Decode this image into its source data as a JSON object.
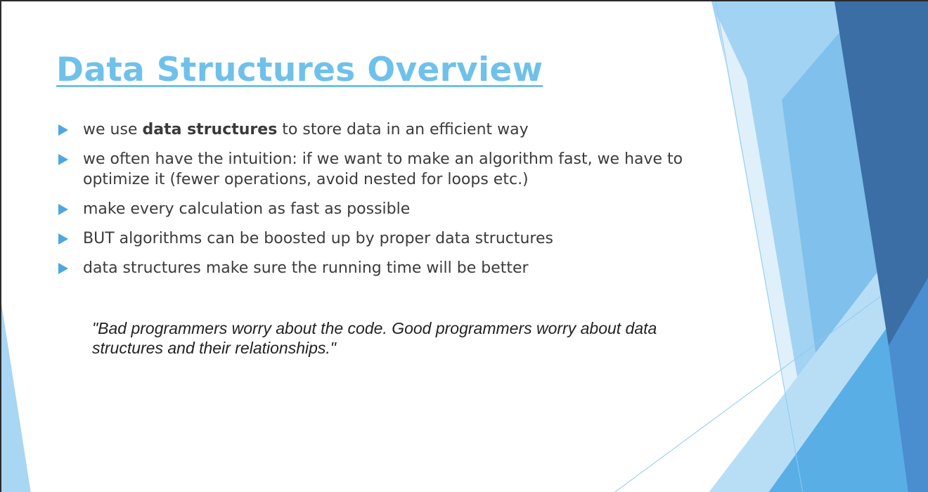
{
  "slide": {
    "title": "Data Structures Overview",
    "bullets": [
      {
        "before": "we use ",
        "bold": "data structures",
        "after": " to store data in an efficient way"
      },
      {
        "text": "we often have the intuition: if we want to make an algorithm fast, we have to optimize it (fewer operations, avoid nested for loops etc.)"
      },
      {
        "text": "make every calculation as fast as possible"
      },
      {
        "text": "BUT algorithms can be boosted up by proper data structures"
      },
      {
        "text": "data structures make sure the running time will be better"
      }
    ],
    "quote": "\"Bad programmers worry about the code. Good programmers worry about data structures and their relationships.\""
  },
  "colors": {
    "title": "#6fc1ea",
    "bullet_marker": "#4fa6e2",
    "body_text": "#3b3b3b",
    "quote_text": "#222222",
    "shape_light": "#a8d6f3",
    "shape_mid": "#5aaee6",
    "shape_dark": "#3a6ea5"
  },
  "icons": {
    "bullet_marker": "triangle-right-icon"
  }
}
